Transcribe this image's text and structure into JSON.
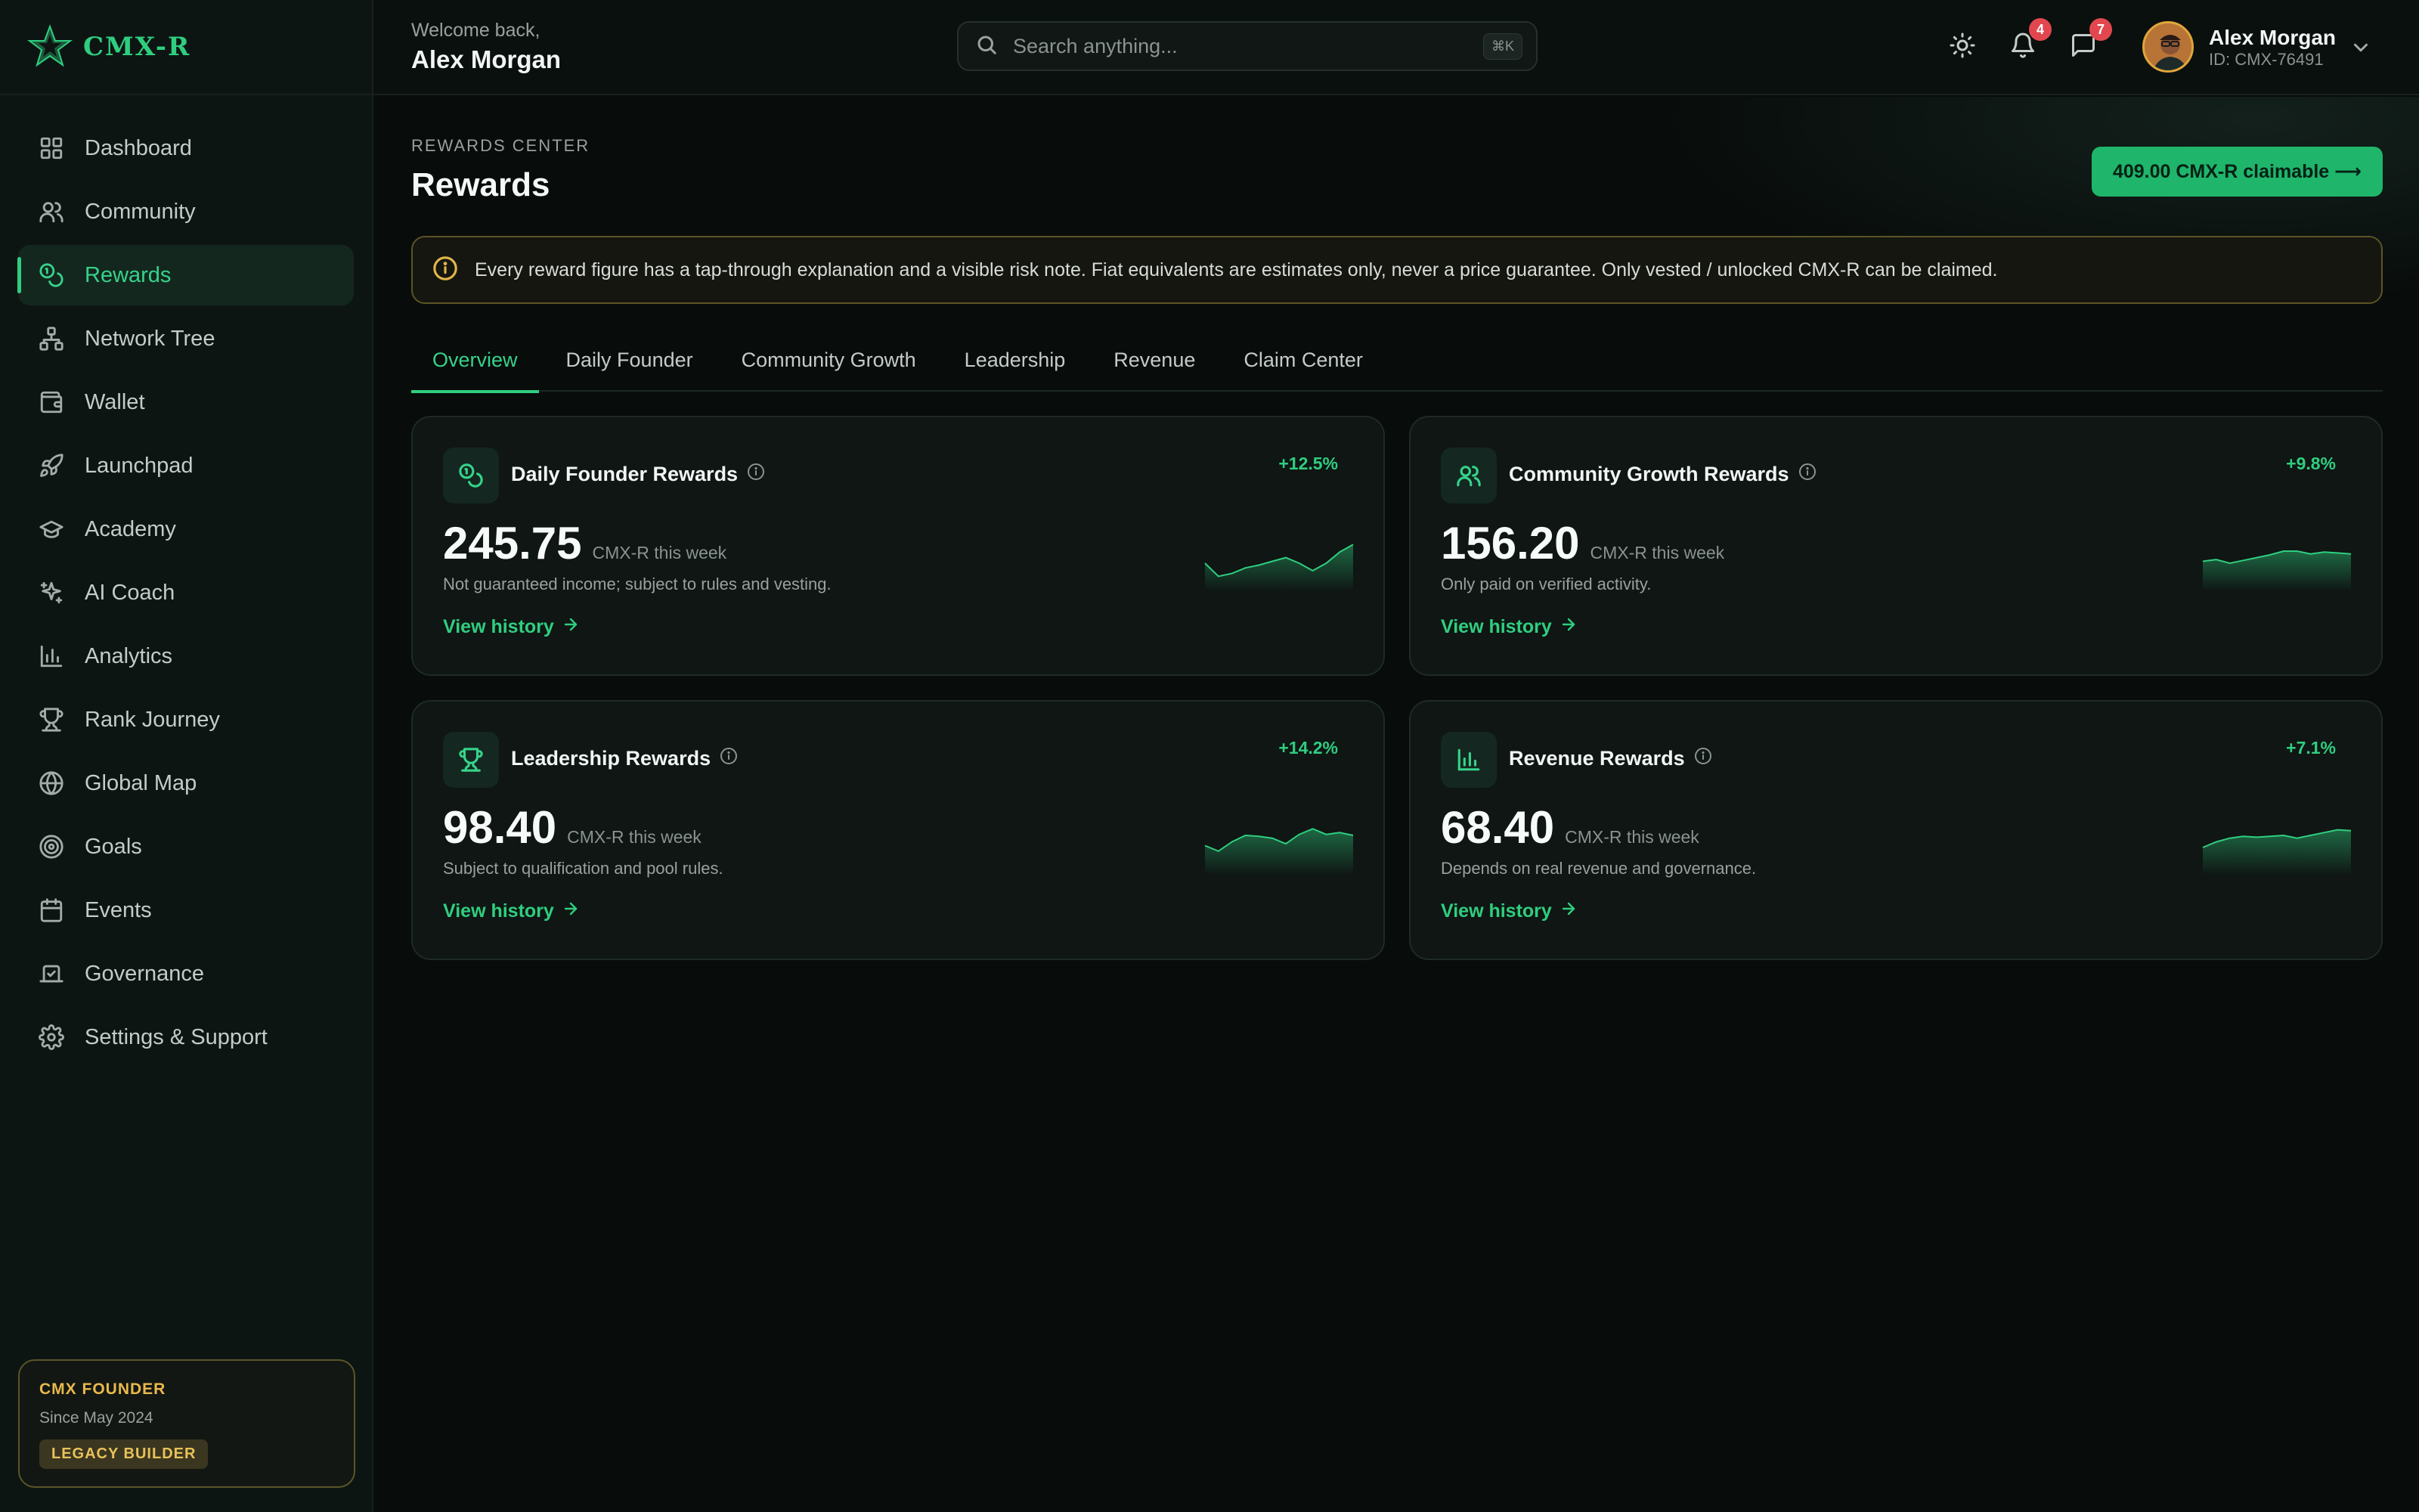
{
  "brand": {
    "name": "CMX-R"
  },
  "header": {
    "welcome": "Welcome back,",
    "user_name": "Alex Morgan",
    "search_placeholder": "Search anything...",
    "search_shortcut": "⌘K",
    "notifications_count": "4",
    "messages_count": "7",
    "profile_name": "Alex Morgan",
    "profile_id": "ID: CMX-76491"
  },
  "sidebar": {
    "items": [
      {
        "label": "Dashboard",
        "icon": "grid-icon",
        "active": false
      },
      {
        "label": "Community",
        "icon": "users-icon",
        "active": false
      },
      {
        "label": "Rewards",
        "icon": "coins-icon",
        "active": true
      },
      {
        "label": "Network Tree",
        "icon": "network-icon",
        "active": false
      },
      {
        "label": "Wallet",
        "icon": "wallet-icon",
        "active": false
      },
      {
        "label": "Launchpad",
        "icon": "rocket-icon",
        "active": false
      },
      {
        "label": "Academy",
        "icon": "graduation-cap-icon",
        "active": false
      },
      {
        "label": "AI Coach",
        "icon": "sparkles-icon",
        "active": false
      },
      {
        "label": "Analytics",
        "icon": "bar-chart-icon",
        "active": false
      },
      {
        "label": "Rank Journey",
        "icon": "trophy-icon",
        "active": false
      },
      {
        "label": "Global Map",
        "icon": "globe-icon",
        "active": false
      },
      {
        "label": "Goals",
        "icon": "target-icon",
        "active": false
      },
      {
        "label": "Events",
        "icon": "calendar-icon",
        "active": false
      },
      {
        "label": "Governance",
        "icon": "vote-icon",
        "active": false
      },
      {
        "label": "Settings & Support",
        "icon": "gear-icon",
        "active": false
      }
    ],
    "founder": {
      "title": "CMX FOUNDER",
      "since": "Since May 2024",
      "badge": "LEGACY BUILDER"
    }
  },
  "main": {
    "eyebrow": "REWARDS CENTER",
    "title": "Rewards",
    "claim_button": "409.00 CMX-R claimable ⟶",
    "notice": "Every reward figure has a tap-through explanation and a visible risk note. Fiat equivalents are estimates only, never a price guarantee. Only vested / unlocked CMX-R can be claimed.",
    "tabs": [
      {
        "label": "Overview",
        "active": true
      },
      {
        "label": "Daily Founder",
        "active": false
      },
      {
        "label": "Community Growth",
        "active": false
      },
      {
        "label": "Leadership",
        "active": false
      },
      {
        "label": "Revenue",
        "active": false
      },
      {
        "label": "Claim Center",
        "active": false
      }
    ],
    "cards": [
      {
        "title": "Daily Founder Rewards",
        "icon": "coins-icon",
        "change": "+12.5%",
        "value": "245.75",
        "unit": "CMX-R this week",
        "note": "Not guaranteed income; subject to rules and vesting.",
        "link": "View history",
        "spark": [
          5,
          3.6,
          3.9,
          4.5,
          4.8,
          5.2,
          5.6,
          5.0,
          4.2,
          5.0,
          6.2,
          7.0
        ]
      },
      {
        "title": "Community Growth Rewards",
        "icon": "users-icon",
        "change": "+9.8%",
        "value": "156.20",
        "unit": "CMX-R this week",
        "note": "Only paid on verified activity.",
        "link": "View history",
        "spark": [
          5.2,
          5.4,
          5.0,
          5.3,
          5.6,
          5.9,
          6.3,
          6.3,
          6.0,
          6.2,
          6.1,
          6.0
        ]
      },
      {
        "title": "Leadership Rewards",
        "icon": "trophy-icon",
        "change": "+14.2%",
        "value": "98.40",
        "unit": "CMX-R this week",
        "note": "Subject to qualification and pool rules.",
        "link": "View history",
        "spark": [
          5.2,
          4.6,
          5.6,
          6.3,
          6.2,
          6.0,
          5.4,
          6.4,
          7.0,
          6.4,
          6.6,
          6.3
        ]
      },
      {
        "title": "Revenue Rewards",
        "icon": "bar-chart-icon",
        "change": "+7.1%",
        "value": "68.40",
        "unit": "CMX-R this week",
        "note": "Depends on real revenue and governance.",
        "link": "View history",
        "spark": [
          5.0,
          5.6,
          6.0,
          6.2,
          6.1,
          6.2,
          6.3,
          6.0,
          6.3,
          6.6,
          6.9,
          6.8
        ]
      }
    ]
  },
  "colors": {
    "accent": "#2fce7f",
    "warning": "#e2b64a",
    "background": "#080c0b"
  }
}
